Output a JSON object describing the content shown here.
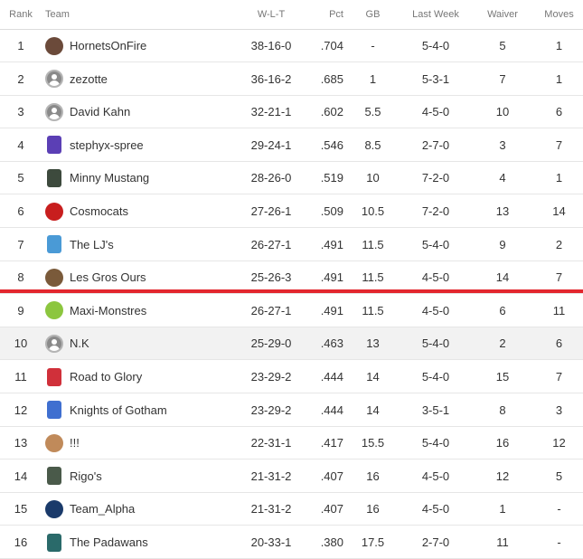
{
  "columns": {
    "rank": "Rank",
    "team": "Team",
    "wlt": "W-L-T",
    "pct": "Pct",
    "gb": "GB",
    "last_week": "Last Week",
    "waiver": "Waiver",
    "moves": "Moves"
  },
  "colors": {
    "cutoff_line": "#e3262e",
    "alt_row": "#f2f2f2"
  },
  "rows": [
    {
      "rank": "1",
      "team": "HornetsOnFire",
      "wlt": "38-16-0",
      "pct": ".704",
      "gb": "-",
      "last_week": "5-4-0",
      "waiver": "5",
      "moves": "1",
      "logo": "hornets-logo-icon",
      "logo_color": "#6b4a3a"
    },
    {
      "rank": "2",
      "team": "zezotte",
      "wlt": "36-16-2",
      "pct": ".685",
      "gb": "1",
      "last_week": "5-3-1",
      "waiver": "7",
      "moves": "1",
      "logo": "default-avatar-icon",
      "logo_color": "#8a8a8a"
    },
    {
      "rank": "3",
      "team": "David Kahn",
      "wlt": "32-21-1",
      "pct": ".602",
      "gb": "5.5",
      "last_week": "4-5-0",
      "waiver": "10",
      "moves": "6",
      "logo": "default-avatar-icon",
      "logo_color": "#8a8a8a"
    },
    {
      "rank": "4",
      "team": "stephyx-spree",
      "wlt": "29-24-1",
      "pct": ".546",
      "gb": "8.5",
      "last_week": "2-7-0",
      "waiver": "3",
      "moves": "7",
      "logo": "jersey-icon",
      "logo_color": "#5b3fb5"
    },
    {
      "rank": "5",
      "team": "Minny Mustang",
      "wlt": "28-26-0",
      "pct": ".519",
      "gb": "10",
      "last_week": "7-2-0",
      "waiver": "4",
      "moves": "1",
      "logo": "jersey-icon",
      "logo_color": "#3d4a3d"
    },
    {
      "rank": "6",
      "team": "Cosmocats",
      "wlt": "27-26-1",
      "pct": ".509",
      "gb": "10.5",
      "last_week": "7-2-0",
      "waiver": "13",
      "moves": "14",
      "logo": "cosmocats-logo-icon",
      "logo_color": "#c81e1e"
    },
    {
      "rank": "7",
      "team": "The LJ's",
      "wlt": "26-27-1",
      "pct": ".491",
      "gb": "11.5",
      "last_week": "5-4-0",
      "waiver": "9",
      "moves": "2",
      "logo": "jersey-icon",
      "logo_color": "#4a9ad6"
    },
    {
      "rank": "8",
      "team": "Les Gros Ours",
      "wlt": "25-26-3",
      "pct": ".491",
      "gb": "11.5",
      "last_week": "4-5-0",
      "waiver": "14",
      "moves": "7",
      "logo": "bear-logo-icon",
      "logo_color": "#7a5a3a"
    },
    {
      "rank": "9",
      "team": "Maxi-Monstres",
      "wlt": "26-27-1",
      "pct": ".491",
      "gb": "11.5",
      "last_week": "4-5-0",
      "waiver": "6",
      "moves": "11",
      "logo": "monster-logo-icon",
      "logo_color": "#8cc63f"
    },
    {
      "rank": "10",
      "team": "N.K",
      "wlt": "25-29-0",
      "pct": ".463",
      "gb": "13",
      "last_week": "5-4-0",
      "waiver": "2",
      "moves": "6",
      "logo": "default-avatar-icon",
      "logo_color": "#8a8a8a"
    },
    {
      "rank": "11",
      "team": "Road to Glory",
      "wlt": "23-29-2",
      "pct": ".444",
      "gb": "14",
      "last_week": "5-4-0",
      "waiver": "15",
      "moves": "7",
      "logo": "jersey-icon",
      "logo_color": "#d0303a"
    },
    {
      "rank": "12",
      "team": "Knights of Gotham",
      "wlt": "23-29-2",
      "pct": ".444",
      "gb": "14",
      "last_week": "3-5-1",
      "waiver": "8",
      "moves": "3",
      "logo": "jersey-icon",
      "logo_color": "#3f6fd0"
    },
    {
      "rank": "13",
      "team": "!!!",
      "wlt": "22-31-1",
      "pct": ".417",
      "gb": "15.5",
      "last_week": "5-4-0",
      "waiver": "16",
      "moves": "12",
      "logo": "photo-avatar-icon",
      "logo_color": "#c08a5a"
    },
    {
      "rank": "14",
      "team": "Rigo's",
      "wlt": "21-31-2",
      "pct": ".407",
      "gb": "16",
      "last_week": "4-5-0",
      "waiver": "12",
      "moves": "5",
      "logo": "jersey-icon",
      "logo_color": "#4a5a4a"
    },
    {
      "rank": "15",
      "team": "Team_Alpha",
      "wlt": "21-31-2",
      "pct": ".407",
      "gb": "16",
      "last_week": "4-5-0",
      "waiver": "1",
      "moves": "-",
      "logo": "alpha-logo-icon",
      "logo_color": "#1a3a6a"
    },
    {
      "rank": "16",
      "team": "The Padawans",
      "wlt": "20-33-1",
      "pct": ".380",
      "gb": "17.5",
      "last_week": "2-7-0",
      "waiver": "11",
      "moves": "-",
      "logo": "jersey-icon",
      "logo_color": "#2a6a6a"
    }
  ]
}
